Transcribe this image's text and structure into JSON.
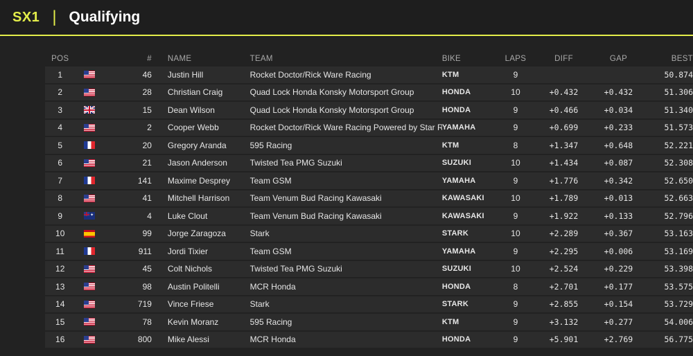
{
  "header": {
    "series": "SX1",
    "separator": "|",
    "session": "Qualifying"
  },
  "columns": {
    "pos": "POS",
    "num": "#",
    "name": "NAME",
    "team": "TEAM",
    "bike": "BIKE",
    "laps": "LAPS",
    "diff": "DIFF",
    "gap": "GAP",
    "best": "BEST"
  },
  "colors": {
    "accent": "#e4ee4a",
    "background": "#1f1f1f",
    "row": "#2c2c2c"
  },
  "rows": [
    {
      "pos": "1",
      "flag": "us",
      "num": "46",
      "name": "Justin Hill",
      "team": "Rocket Doctor/Rick Ware Racing",
      "bike": "KTM",
      "laps": "9",
      "diff": "",
      "gap": "",
      "best": "50.874"
    },
    {
      "pos": "2",
      "flag": "us",
      "num": "28",
      "name": "Christian Craig",
      "team": "Quad Lock Honda Konsky Motorsport Group",
      "bike": "HONDA",
      "laps": "10",
      "diff": "+0.432",
      "gap": "+0.432",
      "best": "51.306"
    },
    {
      "pos": "3",
      "flag": "gb",
      "num": "15",
      "name": "Dean Wilson",
      "team": "Quad Lock Honda Konsky Motorsport Group",
      "bike": "HONDA",
      "laps": "9",
      "diff": "+0.466",
      "gap": "+0.034",
      "best": "51.340"
    },
    {
      "pos": "4",
      "flag": "us",
      "num": "2",
      "name": "Cooper Webb",
      "team": "Rocket Doctor/Rick Ware Racing Powered by Star Ra...",
      "bike": "YAMAHA",
      "laps": "9",
      "diff": "+0.699",
      "gap": "+0.233",
      "best": "51.573"
    },
    {
      "pos": "5",
      "flag": "fr",
      "num": "20",
      "name": "Gregory Aranda",
      "team": "595 Racing",
      "bike": "KTM",
      "laps": "8",
      "diff": "+1.347",
      "gap": "+0.648",
      "best": "52.221"
    },
    {
      "pos": "6",
      "flag": "us",
      "num": "21",
      "name": "Jason Anderson",
      "team": "Twisted Tea PMG Suzuki",
      "bike": "SUZUKI",
      "laps": "10",
      "diff": "+1.434",
      "gap": "+0.087",
      "best": "52.308"
    },
    {
      "pos": "7",
      "flag": "fr",
      "num": "141",
      "name": "Maxime Desprey",
      "team": "Team GSM",
      "bike": "YAMAHA",
      "laps": "9",
      "diff": "+1.776",
      "gap": "+0.342",
      "best": "52.650"
    },
    {
      "pos": "8",
      "flag": "us",
      "num": "41",
      "name": "Mitchell Harrison",
      "team": "Team Venum Bud Racing Kawasaki",
      "bike": "KAWASAKI",
      "laps": "10",
      "diff": "+1.789",
      "gap": "+0.013",
      "best": "52.663"
    },
    {
      "pos": "9",
      "flag": "au",
      "num": "4",
      "name": "Luke Clout",
      "team": "Team Venum Bud Racing Kawasaki",
      "bike": "KAWASAKI",
      "laps": "9",
      "diff": "+1.922",
      "gap": "+0.133",
      "best": "52.796"
    },
    {
      "pos": "10",
      "flag": "es",
      "num": "99",
      "name": "Jorge Zaragoza",
      "team": "Stark",
      "bike": "STARK",
      "laps": "10",
      "diff": "+2.289",
      "gap": "+0.367",
      "best": "53.163"
    },
    {
      "pos": "11",
      "flag": "fr",
      "num": "911",
      "name": "Jordi Tixier",
      "team": "Team GSM",
      "bike": "YAMAHA",
      "laps": "9",
      "diff": "+2.295",
      "gap": "+0.006",
      "best": "53.169"
    },
    {
      "pos": "12",
      "flag": "us",
      "num": "45",
      "name": "Colt Nichols",
      "team": "Twisted Tea PMG Suzuki",
      "bike": "SUZUKI",
      "laps": "10",
      "diff": "+2.524",
      "gap": "+0.229",
      "best": "53.398"
    },
    {
      "pos": "13",
      "flag": "us",
      "num": "98",
      "name": "Austin Politelli",
      "team": "MCR Honda",
      "bike": "HONDA",
      "laps": "8",
      "diff": "+2.701",
      "gap": "+0.177",
      "best": "53.575"
    },
    {
      "pos": "14",
      "flag": "us",
      "num": "719",
      "name": "Vince Friese",
      "team": "Stark",
      "bike": "STARK",
      "laps": "9",
      "diff": "+2.855",
      "gap": "+0.154",
      "best": "53.729"
    },
    {
      "pos": "15",
      "flag": "us",
      "num": "78",
      "name": "Kevin Moranz",
      "team": "595 Racing",
      "bike": "KTM",
      "laps": "9",
      "diff": "+3.132",
      "gap": "+0.277",
      "best": "54.006"
    },
    {
      "pos": "16",
      "flag": "us",
      "num": "800",
      "name": "Mike Alessi",
      "team": "MCR Honda",
      "bike": "HONDA",
      "laps": "9",
      "diff": "+5.901",
      "gap": "+2.769",
      "best": "56.775"
    }
  ]
}
